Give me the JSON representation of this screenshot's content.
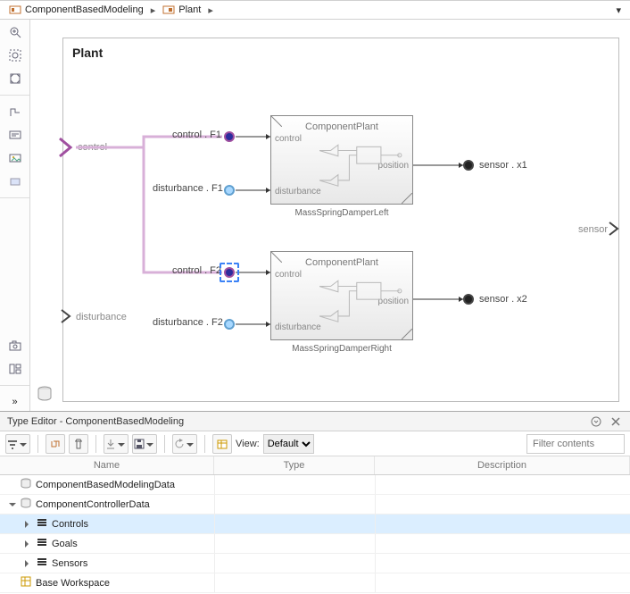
{
  "breadcrumb": {
    "root_icon": "model-icon",
    "root": "ComponentBasedModeling",
    "child_icon": "subsystem-icon",
    "child": "Plant"
  },
  "canvas": {
    "title": "Plant",
    "ports": {
      "control": "control",
      "disturbance": "disturbance",
      "sensor": "sensor"
    },
    "sigs": {
      "ctrlF1": "control . F1",
      "distF1": "disturbance . F1",
      "ctrlF2": "control . F2",
      "distF2": "disturbance . F2",
      "sensX1": "sensor . x1",
      "sensX2": "sensor . x2"
    },
    "block": {
      "inner": "ComponentPlant",
      "pins": {
        "control": "control",
        "disturbance": "disturbance",
        "position": "position"
      },
      "names": {
        "left": "MassSpringDamperLeft",
        "right": "MassSpringDamperRight"
      }
    }
  },
  "panel": {
    "title": "Type Editor - ComponentBasedModeling",
    "viewLbl": "View:",
    "viewValue": "Default",
    "filterPlaceholder": "Filter contents",
    "cols": {
      "name": "Name",
      "type": "Type",
      "desc": "Description"
    },
    "tree": [
      {
        "depth": 0,
        "expand": "none",
        "icon": "db",
        "label": "ComponentBasedModelingData"
      },
      {
        "depth": 0,
        "expand": "open",
        "icon": "db",
        "label": "ComponentControllerData"
      },
      {
        "depth": 1,
        "expand": "closed",
        "icon": "bus",
        "label": "Controls",
        "selected": true
      },
      {
        "depth": 1,
        "expand": "closed",
        "icon": "bus",
        "label": "Goals"
      },
      {
        "depth": 1,
        "expand": "closed",
        "icon": "bus",
        "label": "Sensors"
      },
      {
        "depth": 0,
        "expand": "none",
        "icon": "ws",
        "label": "Base Workspace"
      }
    ]
  }
}
